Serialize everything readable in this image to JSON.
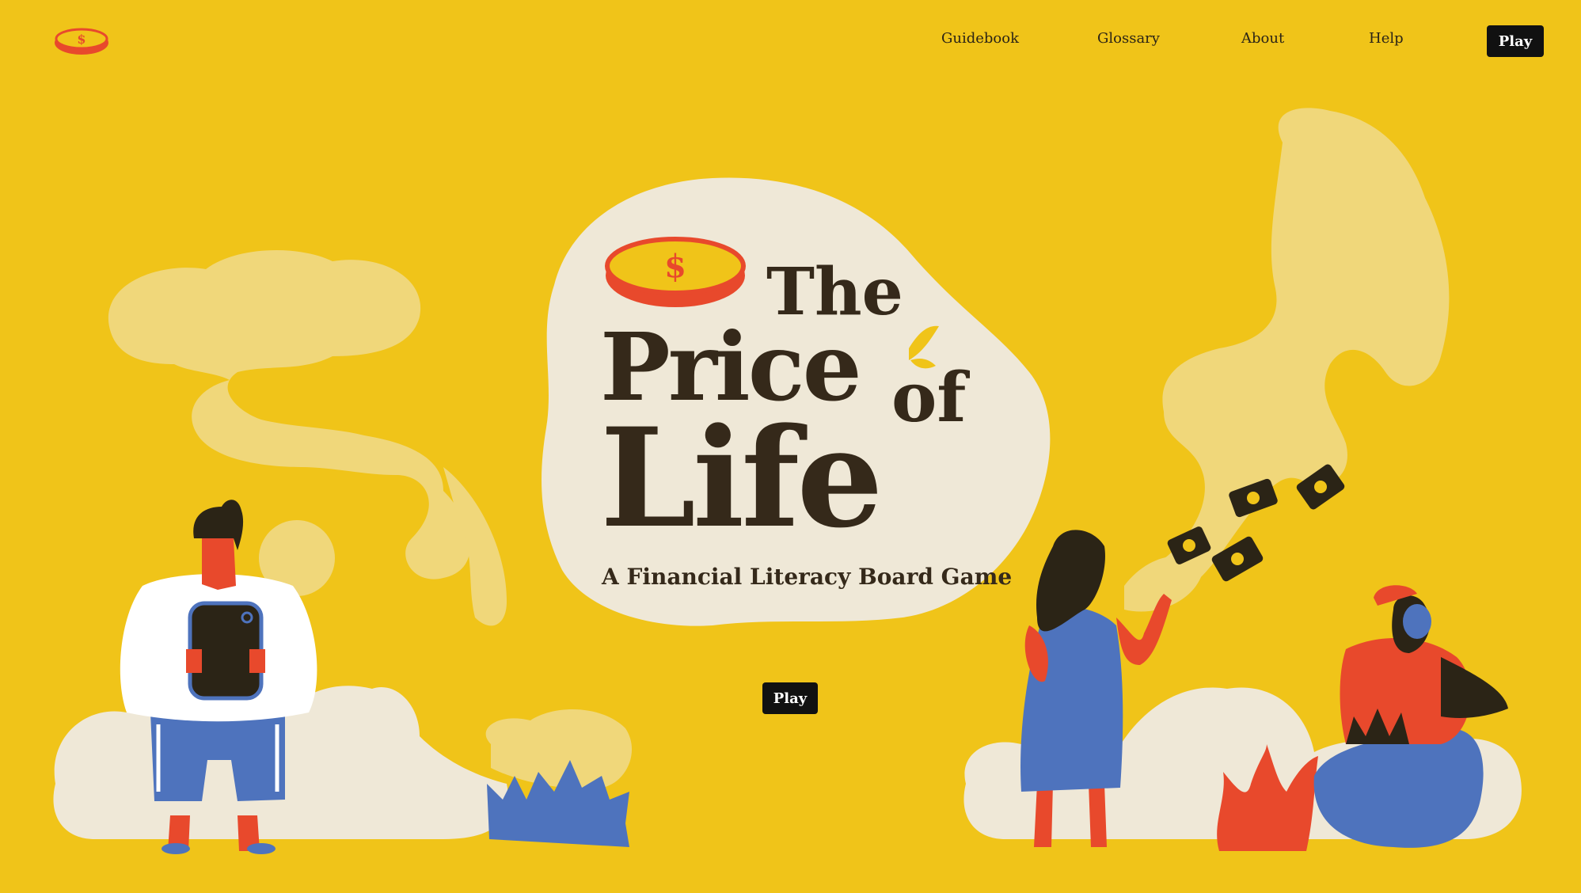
{
  "nav": {
    "logo": "coin-logo-icon",
    "links": [
      "Guidebook",
      "Glossary",
      "About",
      "Help"
    ],
    "play_label": "Play"
  },
  "hero": {
    "title_the": "The",
    "title_price": "Price",
    "title_of": "of",
    "title_life": "Life",
    "subtitle": "A Financial Literacy Board Game",
    "play_label": "Play"
  },
  "colors": {
    "background": "#F0C419",
    "cream": "#EFE8D7",
    "ink": "#35291A",
    "red": "#E8492C",
    "blue": "#4E73BD",
    "pale_yellow": "#F0D77A"
  }
}
